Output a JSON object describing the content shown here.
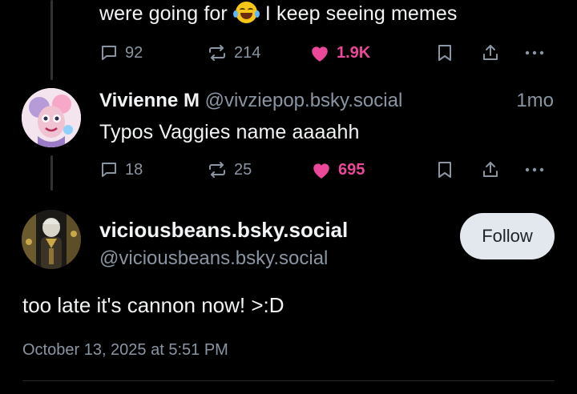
{
  "previous_post": {
    "text_before_emoji": "were going for",
    "emoji_icon": "face-with-tears-of-joy-icon",
    "text_after_emoji": "I keep seeing memes",
    "replies": "92",
    "reposts": "214",
    "likes": "1.9K"
  },
  "reply_post": {
    "display_name": "Vivienne M",
    "handle": "@vivziepop.bsky.social",
    "time": "1mo",
    "text": "Typos Vaggies name aaaahh",
    "replies": "18",
    "reposts": "25",
    "likes": "695"
  },
  "main_post": {
    "display_name": "viciousbeans.bsky.social",
    "handle": "@viciousbeans.bsky.social",
    "follow_label": "Follow",
    "text": "too late it's cannon now! >:D",
    "date": "October 13, 2025 at 5:51 PM"
  },
  "colors": {
    "background": "#000000",
    "text": "#f1f3f5",
    "muted": "#8a95a3",
    "like": "#ec4899",
    "follow_bg": "#e3e8ee"
  }
}
